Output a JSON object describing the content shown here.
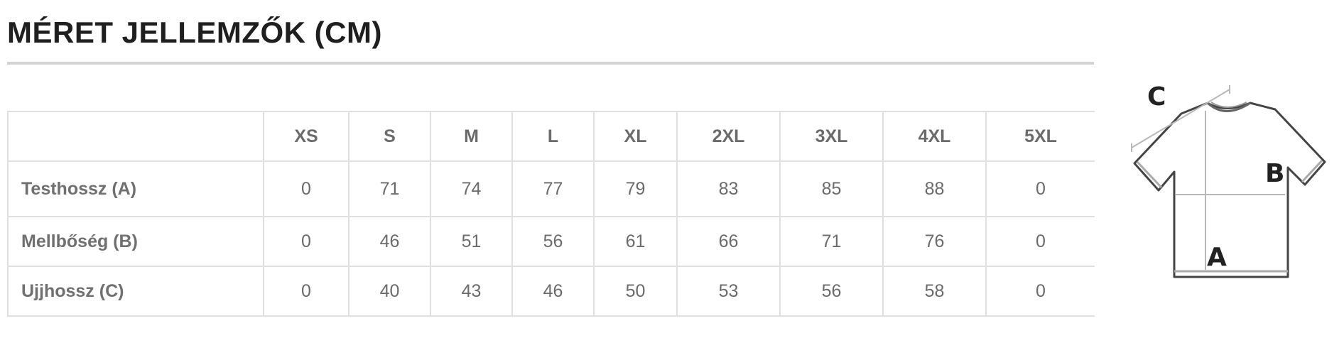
{
  "title": "MÉRET JELLEMZŐK (CM)",
  "table": {
    "corner": "",
    "columns": [
      "XS",
      "S",
      "M",
      "L",
      "XL",
      "2XL",
      "3XL",
      "4XL",
      "5XL"
    ],
    "rows": [
      {
        "label": "Testhossz (A)",
        "values": [
          "0",
          "71",
          "74",
          "77",
          "79",
          "83",
          "85",
          "88",
          "0"
        ]
      },
      {
        "label": "Mellbőség (B)",
        "values": [
          "0",
          "46",
          "51",
          "56",
          "61",
          "66",
          "71",
          "76",
          "0"
        ]
      },
      {
        "label": "Ujjhossz (C)",
        "values": [
          "0",
          "40",
          "43",
          "46",
          "50",
          "53",
          "56",
          "58",
          "0"
        ]
      }
    ]
  },
  "diagram": {
    "label_a": "A",
    "label_b": "B",
    "label_c": "C"
  }
}
